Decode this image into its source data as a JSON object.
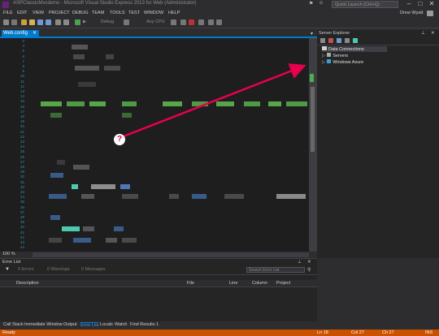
{
  "window": {
    "title": "ASPClassicMvcdemo - Microsoft Visual Studio Express 2013 for Web (Administrator)",
    "search_placeholder": "Quick Launch (Ctrl+Q)",
    "controls": [
      "–",
      "□",
      "✕"
    ]
  },
  "menu": [
    "FILE",
    "EDIT",
    "VIEW",
    "PROJECT",
    "DEBUG",
    "TEAM",
    "TOOLS",
    "TEST",
    "WINDOW",
    "HELP"
  ],
  "user": "Drew Wyatt",
  "toolbar": {
    "config": "Debug",
    "dropdown": "Any CPU"
  },
  "document": {
    "tab_label": "Web.config",
    "zoom": "100 %"
  },
  "line_numbers": [
    "3",
    "4",
    "5",
    "6",
    "7",
    "8",
    "9",
    "10",
    "11",
    "12",
    "13",
    "14",
    "15",
    "16",
    "17",
    "18",
    "19",
    "20",
    "21",
    "22",
    "23",
    "24",
    "25",
    "26",
    "27",
    "28",
    "29",
    "30",
    "31",
    "32",
    "33",
    "34",
    "35",
    "36",
    "37",
    "38",
    "39",
    "40",
    "41",
    "42",
    "43",
    "44"
  ],
  "server_explorer": {
    "title": "Server Explorer",
    "nodes": [
      {
        "label": "Data Connections",
        "selected": true
      },
      {
        "label": "Servers",
        "selected": false
      },
      {
        "label": "Windows Azure",
        "selected": false
      }
    ]
  },
  "error_list": {
    "title": "Error List",
    "filters": [
      "0 Errors",
      "0 Warnings",
      "0 Messages"
    ],
    "search_placeholder": "Search Error List",
    "columns": [
      "Description",
      "File",
      "Line",
      "Column",
      "Project"
    ]
  },
  "bottom_tabs": [
    "Call Stack",
    "Immediate Window",
    "Output",
    "Error List",
    "Locals",
    "Watch",
    "Find Results 1"
  ],
  "active_bottom_tab": "Error List",
  "status": {
    "left": "Ready",
    "ln": "Ln 18",
    "col": "Col 27",
    "ch": "Ch 27",
    "mode": "INS"
  },
  "annotation": {
    "mark": "?"
  },
  "colors": {
    "accent": "#007acc",
    "status_bar": "#ca5100",
    "annotation_arrow": "#e8004d"
  }
}
